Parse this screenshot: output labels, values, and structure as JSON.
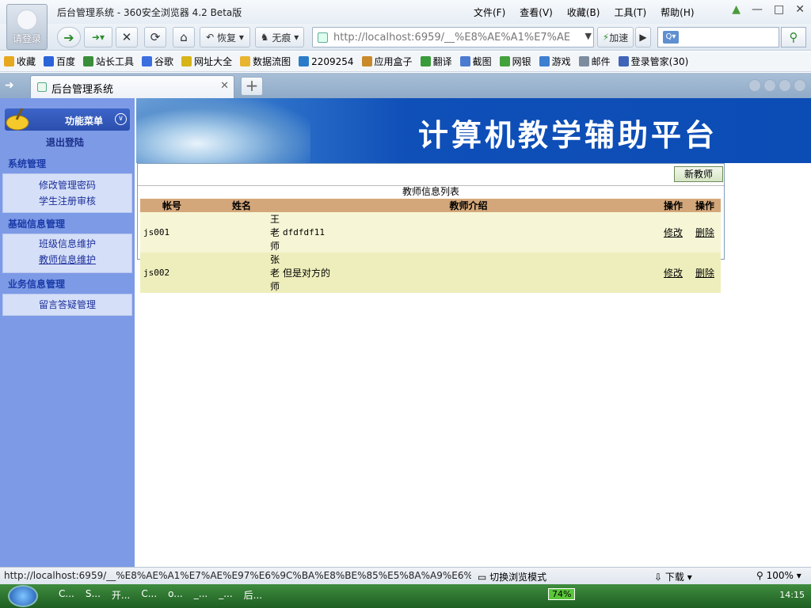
{
  "browser": {
    "title": "后台管理系统 - 360安全浏览器 4.2 Beta版",
    "login_label": "请登录",
    "menus": [
      "文件(F)",
      "查看(V)",
      "收藏(B)",
      "工具(T)",
      "帮助(H)"
    ],
    "restore_label": "恢复",
    "incognito_label": "无痕",
    "address": "http://localhost:6959/__%E8%AE%A1%E7%AE",
    "accelerate_label": "加速",
    "search_placeholder": ""
  },
  "bookmarks": [
    {
      "label": "收藏",
      "color": "#e5a81f"
    },
    {
      "label": "百度",
      "color": "#2b63d8"
    },
    {
      "label": "站长工具",
      "color": "#3a8e3a"
    },
    {
      "label": "谷歌",
      "color": "#3b6fe0"
    },
    {
      "label": "网址大全",
      "color": "#d7b41a"
    },
    {
      "label": "数据流图",
      "color": "#e8b530"
    },
    {
      "label": "2209254",
      "color": "#2a7cc8"
    },
    {
      "label": "应用盒子",
      "color": "#c88a2a"
    },
    {
      "label": "翻译",
      "color": "#3a9b3a"
    },
    {
      "label": "截图",
      "color": "#4b7bd0"
    },
    {
      "label": "网银",
      "color": "#44a23c"
    },
    {
      "label": "游戏",
      "color": "#3d7fd0"
    },
    {
      "label": "邮件",
      "color": "#7d8da0"
    },
    {
      "label": "登录管家(30)",
      "color": "#4064b8"
    }
  ],
  "tab": {
    "title": "后台管理系统"
  },
  "sidebar": {
    "header": "功能菜单",
    "logout": "退出登陆",
    "sections": [
      {
        "title": "系统管理",
        "items": [
          "修改管理密码",
          "学生注册审核"
        ]
      },
      {
        "title": "基础信息管理",
        "items": [
          "班级信息维护",
          "教师信息维护"
        ]
      },
      {
        "title": "业务信息管理",
        "items": [
          "留言答疑管理"
        ]
      }
    ]
  },
  "banner": {
    "title": "计算机教学辅助平台"
  },
  "content": {
    "new_button": "新教师",
    "list_title": "教师信息列表",
    "columns": [
      "帐号",
      "姓名",
      "教师介绍",
      "操作",
      "操作"
    ],
    "rows": [
      {
        "account": "js001",
        "name": "王老师",
        "intro": "dfdfdf11",
        "edit": "修改",
        "delete": "删除"
      },
      {
        "account": "js002",
        "name": "张老师",
        "intro": "但是对方的",
        "edit": "修改",
        "delete": "删除"
      }
    ]
  },
  "statusbar": {
    "url": "http://localhost:6959/__%E8%AE%A1%E7%AE%E97%E6%9C%BA%E8%BE%85%E5%8A%A9%E6%9...",
    "mode": "切换浏览模式",
    "download": "下载",
    "zoom": "100%"
  },
  "taskbar": {
    "items": [
      "C...",
      "S...",
      "开...",
      "C...",
      "o...",
      "_...",
      "_...",
      "后..."
    ],
    "battery": "74%",
    "clock": "14:15"
  }
}
